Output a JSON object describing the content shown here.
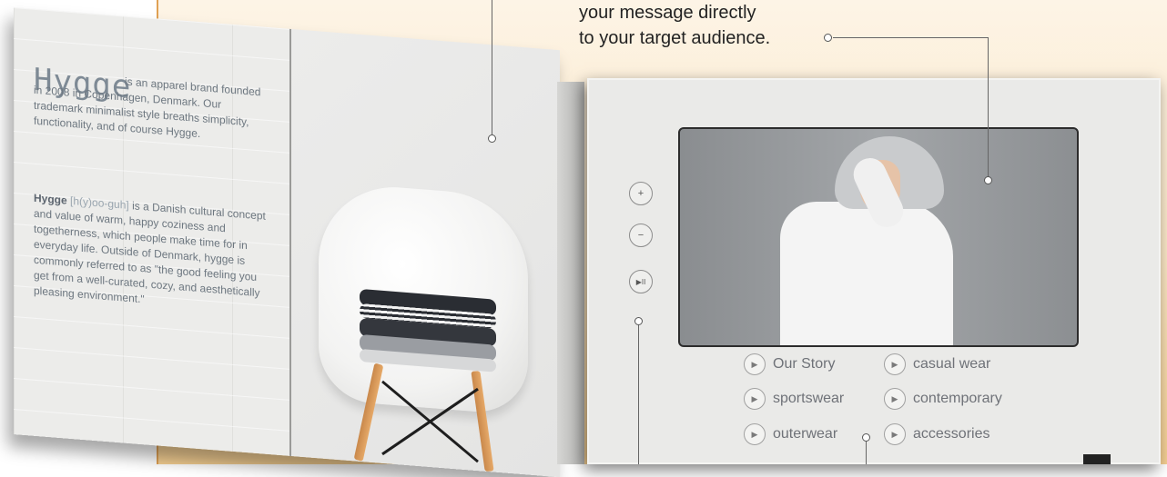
{
  "left_brochure": {
    "brand": "Hygge",
    "intro_text": "is an apparel brand founded in 2008 in Copenhagen, Denmark. Our trademark minimalist style breaths simplicity, functionality, and of course Hygge.",
    "definition_term": "Hygge",
    "definition_pronunciation": "[h(y)oo-guh]",
    "definition_text": "is a Danish cultural concept and value of warm, happy coziness and togetherness, which people make time for in everyday life. Outside of Denmark, hygge is commonly referred to as \"the good feeling you get from a well-curated, cozy, and aesthetically pleasing environment.\""
  },
  "headline": {
    "line1": "your message directly",
    "line2": "to your target audience."
  },
  "controls": {
    "zoom_in_icon": "+",
    "zoom_out_icon": "−",
    "play_pause_icon": "▶II"
  },
  "menu": {
    "items": [
      {
        "label": "Our Story"
      },
      {
        "label": "casual wear"
      },
      {
        "label": "sportswear"
      },
      {
        "label": "contemporary"
      },
      {
        "label": "outerwear"
      },
      {
        "label": "accessories"
      }
    ],
    "item_icon": "play-icon"
  },
  "colors": {
    "background_accent": "#f5cf92",
    "text_muted": "#6d7780",
    "headline_text": "#222222"
  }
}
